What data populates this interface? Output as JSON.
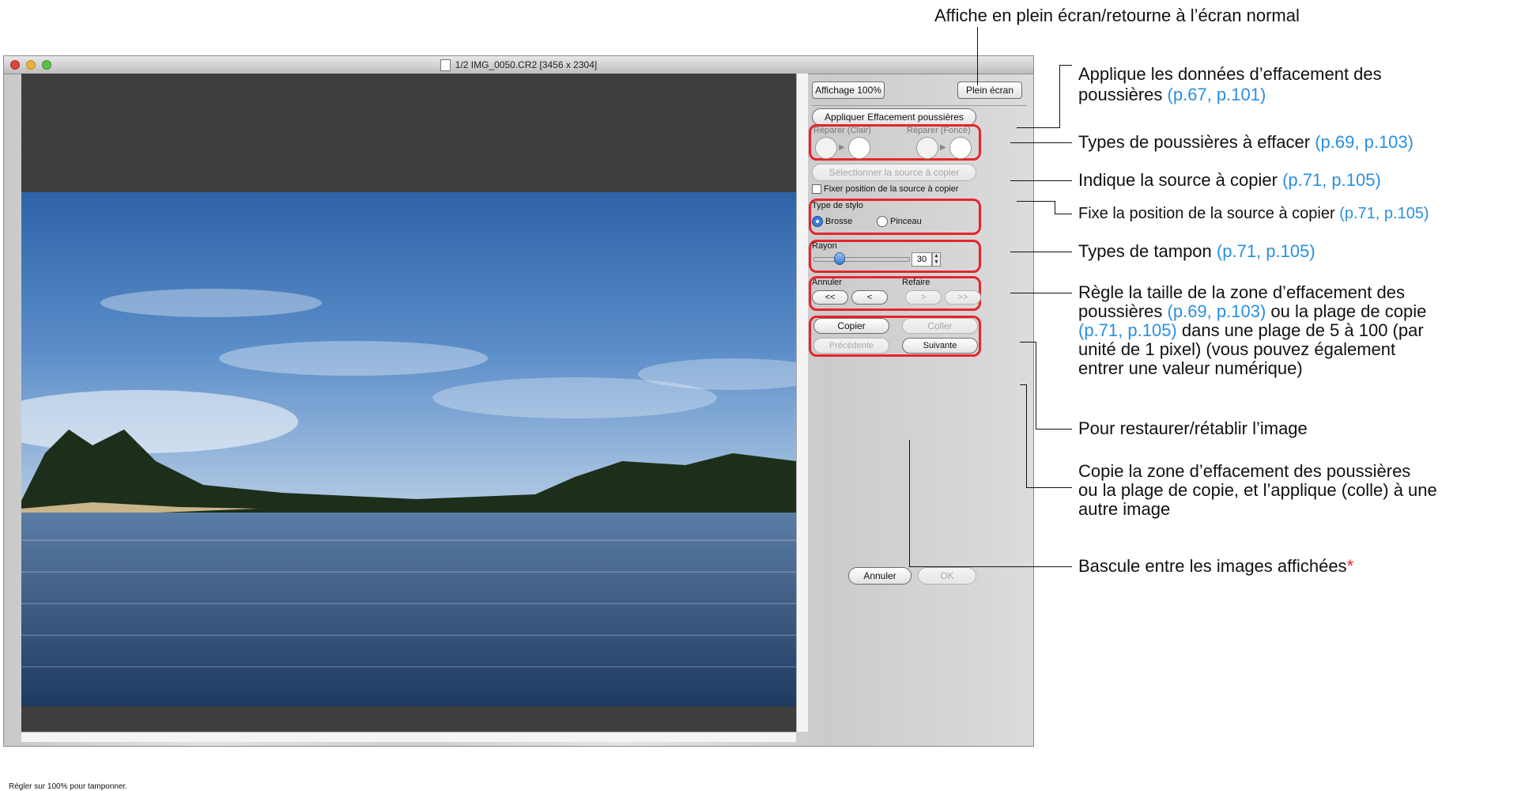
{
  "window": {
    "title": "1/2 IMG_0050.CR2 [3456 x 2304]",
    "status_text": "Régler sur 100% pour tamponner."
  },
  "panel": {
    "view_100": "Affichage 100%",
    "fullscreen": "Plein écran",
    "apply_dust": "Appliquer Effacement poussières",
    "repair_light": "Réparer (Clair)",
    "repair_dark": "Réparer (Foncé)",
    "select_source": "Sélectionner la source à copier",
    "fix_source": "Fixer position de la source à copier",
    "pen_type": "Type de stylo",
    "pen_brush": "Brosse",
    "pen_pencil": "Pinceau",
    "radius_label": "Rayon",
    "radius_value": "30",
    "undo_label": "Annuler",
    "redo_label": "Refaire",
    "undo_all": "<<",
    "undo_one": "<",
    "redo_one": ">",
    "redo_all": ">>",
    "copy": "Copier",
    "paste": "Coller",
    "previous": "Précédente",
    "next": "Suivante",
    "cancel": "Annuler",
    "ok": "OK"
  },
  "annotations": {
    "fullscreen": "Affiche en plein écran/retourne à l’écran normal",
    "apply_1": "Applique les données d’effacement des",
    "apply_2": "poussières",
    "apply_ref": "(p.67, p.101)",
    "types": "Types de poussières à effacer",
    "types_ref": "(p.69, p.103)",
    "source": "Indique la source à copier",
    "source_ref": "(p.71, p.105)",
    "fix": "Fixe la position de la source à copier",
    "fix_ref": "(p.71, p.105)",
    "stamp": "Types de tampon",
    "stamp_ref": "(p.71, p.105)",
    "radius_1": "Règle la taille de la zone d’effacement des",
    "radius_2": "poussières",
    "radius_ref1": "(p.69, p.103)",
    "radius_2b": "ou la plage de copie",
    "radius_ref2": "(p.71, p.105)",
    "radius_3b": "dans une plage de 5 à 100 (par",
    "radius_4": "unité de 1 pixel) (vous pouvez également",
    "radius_5": "entrer une valeur numérique)",
    "restore": "Pour restaurer/rétablir l’image",
    "copy_1": "Copie la zone d’effacement des poussières",
    "copy_2": "ou la plage de copie, et l’applique (colle) à une",
    "copy_3": "autre image",
    "switch": "Bascule entre les images affichées",
    "switch_star": "*"
  },
  "colors": {
    "highlight_red": "#e6252b",
    "reference_blue": "#2a8fe0",
    "viewer_bg": "#3e3e3e"
  }
}
